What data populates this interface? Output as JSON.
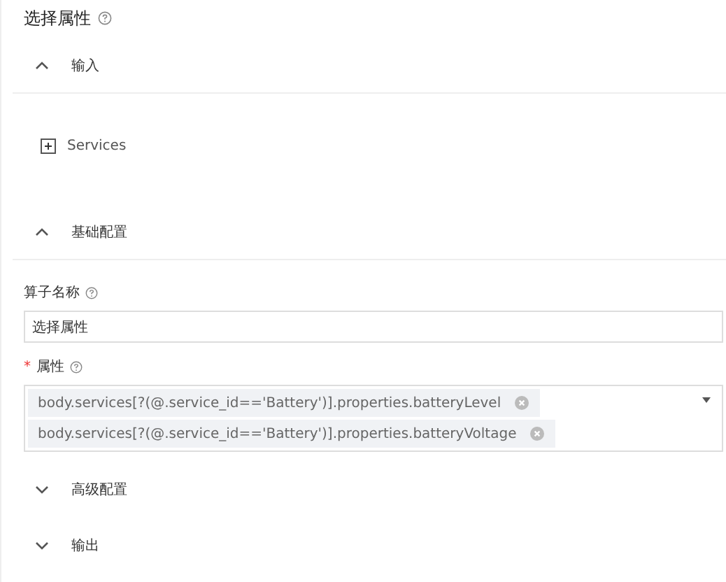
{
  "panel": {
    "title": "选择属性"
  },
  "sections": [
    {
      "label": "输入",
      "expanded": true,
      "kind": "tree",
      "items": [
        {
          "label": "Services",
          "expanded": false
        }
      ]
    },
    {
      "label": "基础配置",
      "expanded": true,
      "kind": "form",
      "fields": [
        {
          "kind": "text",
          "label": "算子名称",
          "value": "选择属性"
        },
        {
          "kind": "tags",
          "marker": "*",
          "label": "属性",
          "tags": [
            "body.services[?(@.service_id=='Battery')].properties.batteryLevel",
            "body.services[?(@.service_id=='Battery')].properties.batteryVoltage"
          ]
        }
      ]
    },
    {
      "label": "高级配置",
      "expanded": false
    },
    {
      "label": "输出",
      "expanded": false
    }
  ]
}
